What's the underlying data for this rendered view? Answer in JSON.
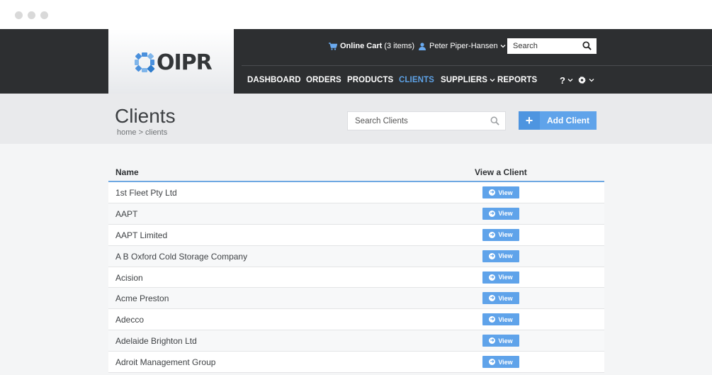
{
  "header": {
    "logo_text": "OIPR",
    "cart_label": "Online Cart",
    "cart_count": "(3 items)",
    "user_name": "Peter Piper-Hansen",
    "search_placeholder": "Search"
  },
  "nav": {
    "items": [
      {
        "label": "DASHBOARD"
      },
      {
        "label": "ORDERS"
      },
      {
        "label": "PRODUCTS"
      },
      {
        "label": "CLIENTS"
      },
      {
        "label": "SUPPLIERS"
      },
      {
        "label": "REPORTS"
      }
    ],
    "help_label": "?",
    "active": "CLIENTS"
  },
  "page": {
    "title": "Clients",
    "breadcrumb": "home > clients",
    "search_placeholder": "Search Clients",
    "add_button": "Add Client"
  },
  "table": {
    "columns": [
      "Name",
      "View a Client"
    ],
    "view_label": "View",
    "rows": [
      {
        "name": "1st Fleet Pty Ltd"
      },
      {
        "name": "AAPT"
      },
      {
        "name": "AAPT Limited"
      },
      {
        "name": "A B Oxford Cold Storage Company"
      },
      {
        "name": "Acision"
      },
      {
        "name": "Acme Preston"
      },
      {
        "name": "Adecco"
      },
      {
        "name": "Adelaide Brighton Ltd"
      },
      {
        "name": "Adroit Management Group"
      }
    ]
  },
  "colors": {
    "accent": "#5fa3ea",
    "topbar": "#2d2f31",
    "band": "#e9eaec"
  }
}
